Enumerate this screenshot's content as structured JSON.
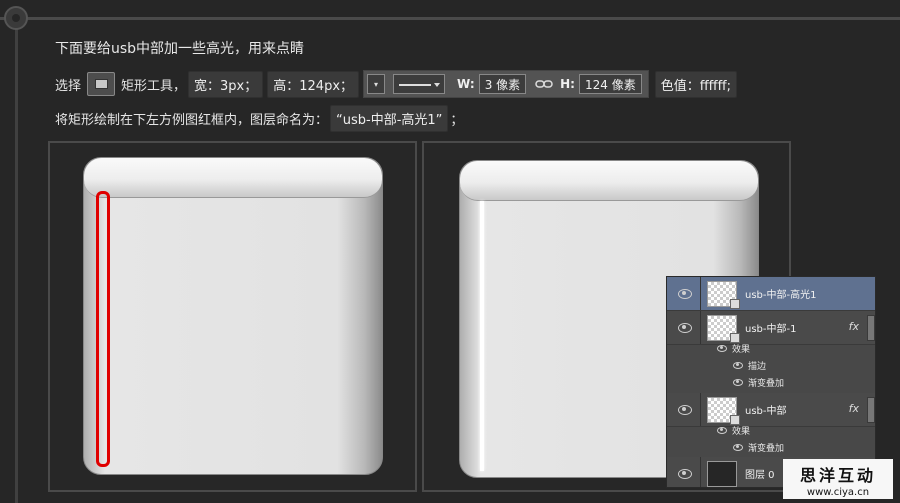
{
  "instructions": {
    "line1": "下面要给usb中部加一些高光，用来点睛",
    "select_label": "选择",
    "tool_label": "矩形工具，",
    "width_text": "宽：3px；",
    "height_text": "高：124px；",
    "w_label": "W:",
    "w_value": "3 像素",
    "h_label": "H:",
    "h_value": "124 像素",
    "color_text": "色值：ffffff;",
    "line3_prefix": "将矩形绘制在下左方例图红框内，图层命名为：",
    "layer_name_quote": "“usb-中部-高光1”",
    "line3_suffix": "；"
  },
  "layers_panel": {
    "layers": [
      {
        "name": "usb-中部-高光1",
        "selected": true,
        "fx": ""
      },
      {
        "name": "usb-中部-1",
        "selected": false,
        "fx": "fx"
      },
      {
        "name": "usb-中部",
        "selected": false,
        "fx": "fx"
      },
      {
        "name": "图层 0",
        "selected": false,
        "fx": ""
      }
    ],
    "effects_label": "效果",
    "effect_stroke": "描边",
    "effect_gradient": "渐变叠加"
  },
  "watermark": {
    "title": "思洋互动",
    "url": "www.ciya.cn"
  },
  "colors": {
    "background": "#262626",
    "highlight_box": "#e00000",
    "selected_layer": "#5f7190",
    "highlight_fill": "#ffffff"
  },
  "icons": [
    "rectangle-tool-icon",
    "link-icon",
    "eye-icon",
    "layer-link-icon"
  ]
}
